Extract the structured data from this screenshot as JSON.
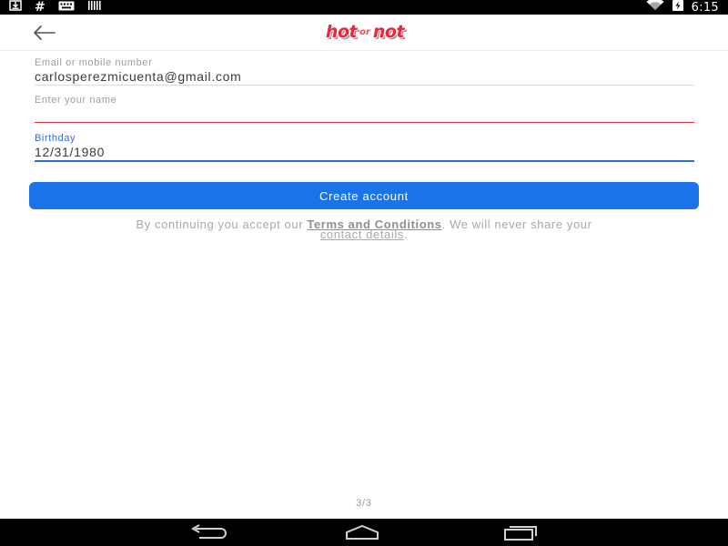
{
  "status_bar": {
    "time": "6:15",
    "hash_symbol": "#",
    "left_icons": [
      "download-icon",
      "hash-icon",
      "keyboard-icon",
      "barcode-icon"
    ],
    "right_icons": [
      "wifi-icon",
      "battery-icon"
    ]
  },
  "header": {
    "logo": {
      "hot": "hot",
      "or": "or",
      "not": "not"
    },
    "back_icon": "arrow-left-icon"
  },
  "form": {
    "email": {
      "label": "Email or mobile number",
      "value": "carlosperezmicuenta@gmail.com"
    },
    "name": {
      "label": "Enter your name",
      "value": ""
    },
    "birthday": {
      "label": "Birthday",
      "value": "12/31/1980"
    }
  },
  "create_button": {
    "label": "Create account"
  },
  "terms": {
    "prefix": "By continuing you accept our ",
    "terms_link": "Terms and Conditions",
    "middle": ". We will never share your ",
    "contact_link": "contact details",
    "suffix": "."
  },
  "pager": {
    "text": "3/3"
  },
  "colors": {
    "accent": "#1a73e8",
    "error_line": "#e0343f",
    "focus_line": "#2b6fd6",
    "brand_red": "#e8283c"
  }
}
